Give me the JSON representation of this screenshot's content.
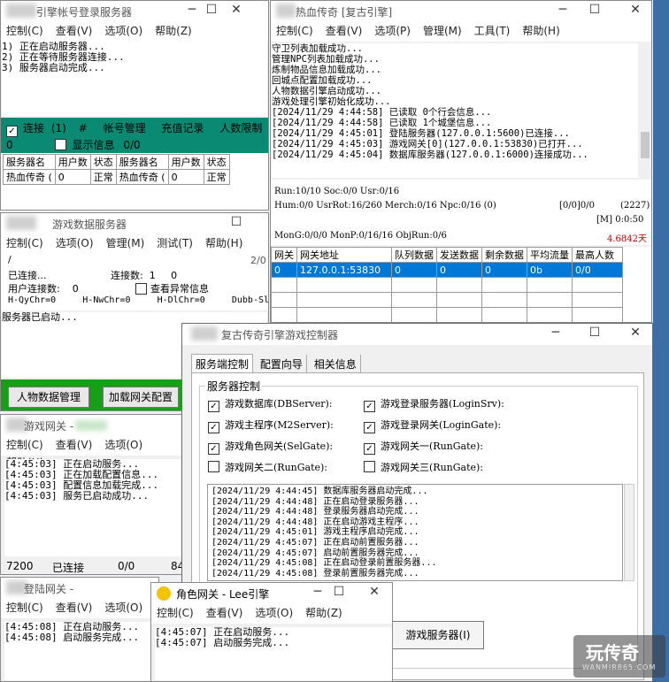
{
  "login_win": {
    "title": "引擎帐号登录服务器",
    "menu": [
      "控制(C)",
      "查看(V)",
      "选项(O)",
      "帮助(Z)"
    ],
    "log": "1) 正在启动服务器...\n2) 正在等待服务器连接...\n3) 服务器启动完成...",
    "bar": {
      "connect": "连接",
      "count": "(1)",
      "hash": "#",
      "acct": "帐号管理",
      "recharge": "充值记录",
      "limit": "人数限制",
      "zero": "0",
      "show": "显示信息",
      "ratio": "0/0"
    },
    "headers": [
      "服务器名",
      "用户数",
      "状态",
      "服务器名",
      "用户数",
      "状态"
    ],
    "row": [
      "热血传奇 (",
      "0",
      "正常",
      "热血传奇 (",
      "0",
      "正常"
    ]
  },
  "main_win": {
    "title": "热血传奇 [复古引擎]",
    "menu": [
      "控制(C)",
      "查看(V)",
      "选项(P)",
      "管理(M)",
      "工具(T)",
      "帮助(H)"
    ],
    "log": "守卫列表加载成功...\n管理NPC列表加载成功...\n炼制物品信息加载成功...\n回城点配置加载成功...\n人物数据引擎启动成功...\n游戏处理引擎初始化成功...\n[2024/11/29 4:44:58] 已读取 0个行会信息...\n[2024/11/29 4:44:58] 已读取 1个城堡信息...\n[2024/11/29 4:45:01] 登陆服务器(127.0.0.1:5600)已连接...\n[2024/11/29 4:45:03] 游戏网关[0](127.0.0.1:53830)已打开...\n[2024/11/29 4:45:04] 数据库服务器(127.0.0.1:6000)连接成功...",
    "status1": "Run:10/10 Soc:0/0 Usr:0/16",
    "status2": "Hum:0/0 UsrRot:16/260 Merch:0/16 Npc:0/16 (0)",
    "status2r": "[0/0]0/0",
    "status2v": "(2227)",
    "status3r": "[M] 0:0:50",
    "status4": "MonG:0/0/0 MonP:0/16/16 ObjRun:0/6",
    "status4r": "4.6842天",
    "gw_headers": [
      "网关",
      "网关地址",
      "队列数据",
      "发送数据",
      "剩余数据",
      "平均流量",
      "最高人数"
    ],
    "gw_row": [
      "0",
      "127.0.0.1:53830",
      "0",
      "0",
      "0",
      "0b",
      "0/0"
    ]
  },
  "db_win": {
    "title": "游戏数据服务器",
    "menu": [
      "控制(C)",
      "选项(O)",
      "管理(M)",
      "测试(T)",
      "帮助(H)"
    ],
    "slash": "/",
    "ratio": "2/0",
    "conn": "已连接...",
    "connCount": "连接数:  1     0",
    "userConn": "用户连接数:    0",
    "abnormal": "查看异常信息",
    "counters": "H-QyChr=0     H-NwChr=0     H-DlChr=0     Dubb-Sl=0",
    "log": "服务器已启动...",
    "btn_people": "人物数据管理",
    "btn_gateway": "加载网关配置"
  },
  "gate_win": {
    "title": "游戏网关 -",
    "menu": [
      "控制(C)",
      "查看(V)",
      "选项(O)",
      "帮助(H)"
    ],
    "log": "[4:45:03] 正在启动服务...\n[4:45:03] 正在加载配置信息...\n[4:45:03] 配置信息加载完成...\n[4:45:03] 服务已启动成功...",
    "status": [
      "7200",
      "已连接",
      "0/0",
      "84"
    ]
  },
  "logingate_win": {
    "title": "登陆网关 -",
    "menu": [
      "控制(C)",
      "查看(V)",
      "选项(O)"
    ],
    "log": "[4:45:08] 正在启动服务...\n[4:45:08] 启动服务完成..."
  },
  "selgate_win": {
    "title": "角色网关 - Lee引擎",
    "menu": [
      "控制(C)",
      "查看(V)",
      "选项(O)",
      "帮助(Z)"
    ],
    "log": "[4:45:07] 正在启动服务...\n[4:45:07] 启动服务完成..."
  },
  "ctrl_win": {
    "title": "复古传奇引擎游戏控制器",
    "tabs": [
      "服务端控制",
      "配置向导",
      "相关信息"
    ],
    "group": "服务器控制",
    "checks": [
      {
        "label": "游戏数据库(DBServer):",
        "on": true
      },
      {
        "label": "游戏登录服务器(LoginSrv):",
        "on": true
      },
      {
        "label": "游戏主程序(M2Server):",
        "on": true
      },
      {
        "label": "游戏登录网关(LoginGate):",
        "on": true
      },
      {
        "label": "游戏角色网关(SelGate):",
        "on": true
      },
      {
        "label": "游戏网关一(RunGate):",
        "on": true
      },
      {
        "label": "游戏网关二(RunGate):",
        "on": false
      },
      {
        "label": "游戏网关三(RunGate):",
        "on": false
      }
    ],
    "log": "[2024/11/29 4:44:45] 数据库服务器启动完成...\n[2024/11/29 4:44:48] 正在启动登录服务器...\n[2024/11/29 4:44:48] 登录服务器启动完成...\n[2024/11/29 4:44:48] 正在启动游戏主程序...\n[2024/11/29 4:45:01] 游戏主程序启动完成...\n[2024/11/29 4:45:07] 正在启动前置服务器...\n[2024/11/29 4:45:07] 启动前置服务器完成...\n[2024/11/29 4:45:08] 正在启动登录前置服务器...\n[2024/11/29 4:45:08] 登录前置服务器完成...",
    "btn": "游戏服务器(I)"
  },
  "watermark": {
    "name": "玩传奇",
    "url": "WANMIR865.COM"
  }
}
